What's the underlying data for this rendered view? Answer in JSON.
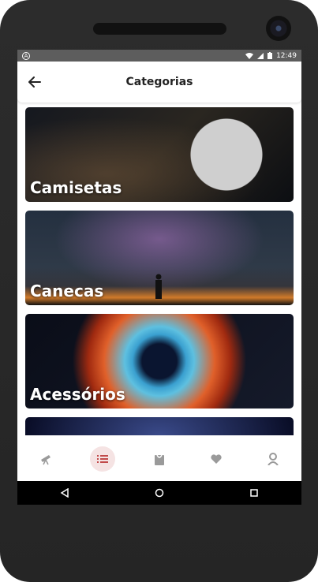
{
  "status": {
    "time": "12:49"
  },
  "appbar": {
    "title": "Categorias"
  },
  "categories": [
    {
      "label": "Camisetas"
    },
    {
      "label": "Canecas"
    },
    {
      "label": "Acessórios"
    }
  ],
  "nav": {
    "items": [
      {
        "icon": "telescope-icon"
      },
      {
        "icon": "list-icon"
      },
      {
        "icon": "bag-icon"
      },
      {
        "icon": "heart-icon"
      },
      {
        "icon": "user-icon"
      }
    ],
    "active_index": 1
  },
  "colors": {
    "accent": "#c14a4a",
    "icon_inactive": "#9a9a9a",
    "statusbar": "#5d5d5d"
  }
}
